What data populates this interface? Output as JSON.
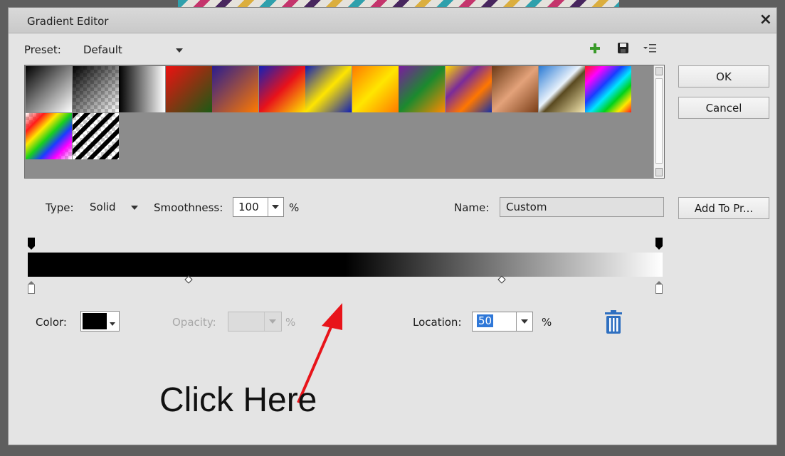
{
  "dialog": {
    "title": "Gradient Editor",
    "close_label": "×"
  },
  "preset": {
    "label": "Preset:",
    "value": "Default",
    "icons": [
      "add-icon",
      "save-icon",
      "menu-icon"
    ]
  },
  "swatches": [
    {
      "name": "swatch-foreground-to-background",
      "bg": "linear-gradient(135deg,#000 0%,#fff 100%)"
    },
    {
      "name": "swatch-foreground-to-transparent",
      "bg": "linear-gradient(135deg,rgba(0,0,0,1) 0%,rgba(0,0,0,0) 100%), conic-gradient(#ccc 0 25%,#fff 0 50%,#ccc 0 75%,#fff 0) 0 0/10px 10px"
    },
    {
      "name": "swatch-black-white",
      "bg": "linear-gradient(90deg,#000 0%,#fff 100%)"
    },
    {
      "name": "swatch-red-green",
      "bg": "linear-gradient(135deg,#e11 0%,#1a5b14 100%)"
    },
    {
      "name": "swatch-violet-orange",
      "bg": "linear-gradient(135deg,#2a1c8f 0%,#ff7a00 100%)"
    },
    {
      "name": "swatch-blue-red-yellow",
      "bg": "linear-gradient(135deg,#1220b8 0%,#e8121a 50%,#ffe800 100%)"
    },
    {
      "name": "swatch-blue-yellow-blue",
      "bg": "linear-gradient(135deg,#101fb5 0%,#ffe500 50%,#101fb5 100%)"
    },
    {
      "name": "swatch-orange-yellow-orange",
      "bg": "linear-gradient(135deg,#ff7a00 0%,#ffe600 50%,#ff7a00 100%)"
    },
    {
      "name": "swatch-violet-green-orange",
      "bg": "linear-gradient(135deg,#7c1aa0 0%,#1b8a2e 50%,#ff8a00 100%)"
    },
    {
      "name": "swatch-yellow-violet-orange-blue",
      "bg": "linear-gradient(135deg,#ffd900 0%,#7a2b9a 35%,#ff7700 65%,#1430a8 100%)"
    },
    {
      "name": "swatch-copper",
      "bg": "linear-gradient(135deg,#6b3a16 0%,#e3a27a 50%,#7a3e18 100%)"
    },
    {
      "name": "swatch-chrome",
      "bg": "linear-gradient(135deg,#2a7ad4 0%,#e9f2fb 45%,#5a4a20 55%,#f4e7b0 100%)"
    },
    {
      "name": "swatch-spectrum",
      "bg": "linear-gradient(135deg,#ff1a1a 0%,#ff00ff 20%,#1a3cff 40%,#00e5ff 55%,#00d21a 70%,#ffe600 85%,#ff1a1a 100%)"
    },
    {
      "name": "swatch-transparent-rainbow",
      "bg": "linear-gradient(135deg,rgba(0,0,0,0) 0%,#ff1a1a 20%,#ffe600 35%,#1ad21a 50%,#1a3cff 65%,#ff00ff 80%,rgba(0,0,0,0) 100%), conic-gradient(#ccc 0 25%,#fff 0 50%,#ccc 0 75%,#fff 0) 0 0/10px 10px"
    },
    {
      "name": "swatch-transparent-stripes",
      "bg": "repeating-linear-gradient(135deg,#000 0 6px,rgba(0,0,0,0) 6px 12px), conic-gradient(#ccc 0 25%,#fff 0 50%,#ccc 0 75%,#fff 0) 0 0/10px 10px"
    }
  ],
  "buttons": {
    "ok": "OK",
    "cancel": "Cancel",
    "add_to_preset": "Add To Pr..."
  },
  "type": {
    "label": "Type:",
    "value": "Solid"
  },
  "smoothness": {
    "label": "Smoothness:",
    "value": "100",
    "unit": "%"
  },
  "name": {
    "label": "Name:",
    "value": "Custom"
  },
  "gradient": {
    "colors": [
      "#000000",
      "#ffffff"
    ],
    "midpoint_percent": 50
  },
  "stops_panel": {
    "color_label": "Color:",
    "color_value": "#000000",
    "opacity_label": "Opacity:",
    "opacity_unit": "%",
    "location_label": "Location:",
    "location_value": "50",
    "location_unit": "%"
  },
  "annotation": {
    "text": "Click Here",
    "arrow_color": "#e8141a"
  }
}
